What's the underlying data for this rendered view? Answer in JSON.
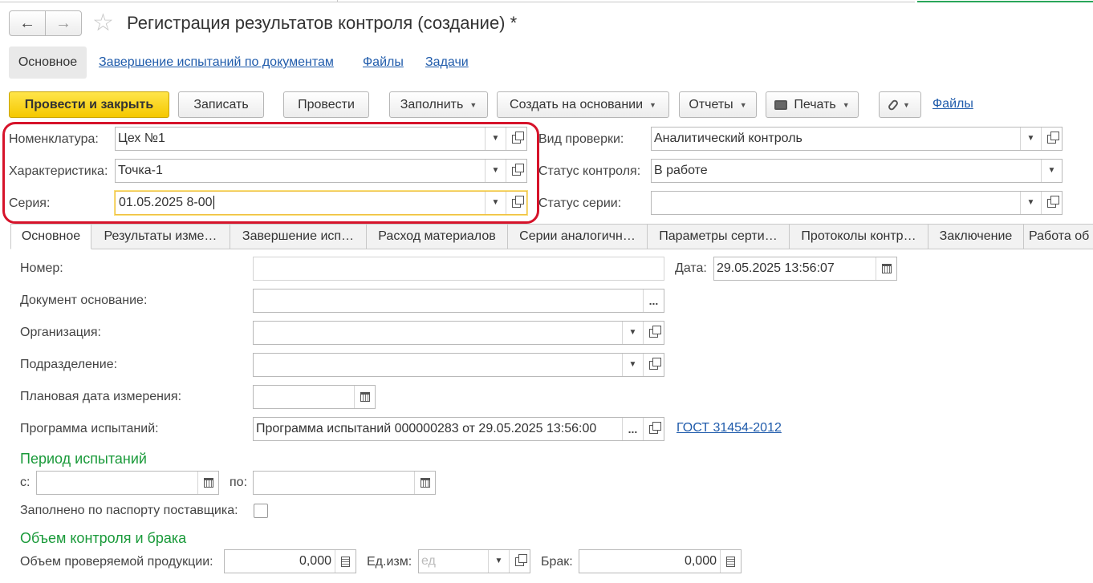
{
  "window": {
    "title": "Регистрация результатов контроля (создание) *"
  },
  "section_tabs": [
    "Основное",
    "Завершение испытаний по документам",
    "Файлы",
    "Задачи"
  ],
  "toolbar": {
    "post_close": "Провести и закрыть",
    "save": "Записать",
    "post": "Провести",
    "fill": "Заполнить",
    "create_based": "Создать на основании",
    "reports": "Отчеты",
    "print": "Печать",
    "files_link": "Файлы"
  },
  "header": {
    "nomenclature": {
      "label": "Номенклатура:",
      "value": "Цех №1"
    },
    "characteristic": {
      "label": "Характеристика:",
      "value": "Точка-1"
    },
    "series": {
      "label": "Серия:",
      "value": "01.05.2025 8-00"
    },
    "check_type": {
      "label": "Вид проверки:",
      "value": "Аналитический контроль"
    },
    "control_status": {
      "label": "Статус контроля:",
      "value": "В работе"
    },
    "series_status": {
      "label": "Статус серии:",
      "value": ""
    }
  },
  "tabs": [
    "Основное",
    "Результаты изме…",
    "Завершение исп…",
    "Расход материалов",
    "Серии аналогичн…",
    "Параметры серти…",
    "Протоколы контр…",
    "Заключение",
    "Работа об"
  ],
  "main": {
    "number": {
      "label": "Номер:",
      "value": ""
    },
    "date": {
      "label": "Дата:",
      "value": "29.05.2025 13:56:07"
    },
    "base_doc": {
      "label": "Документ основание:",
      "value": ""
    },
    "organization": {
      "label": "Организация:",
      "value": ""
    },
    "department": {
      "label": "Подразделение:",
      "value": ""
    },
    "planned_date": {
      "label": "Плановая дата измерения:",
      "value": "  .  ."
    },
    "program": {
      "label": "Программа испытаний:",
      "value": "Программа испытаний 000000283 от 29.05.2025 13:56:00",
      "link": "ГОСТ 31454-2012"
    },
    "period": {
      "heading": "Период испытаний",
      "from_label": "с:",
      "from_value": "  .  .        :  :",
      "to_label": "по:",
      "to_value": "  .  .        :  :"
    },
    "by_passport": {
      "label": "Заполнено по паспорту поставщика:"
    },
    "volume": {
      "heading": "Объем контроля и брака",
      "checked_label": "Объем проверяемой продукции:",
      "checked_value": "0,000",
      "unit_label": "Ед.изм:",
      "unit_placeholder": "ед",
      "defect_label": "Брак:",
      "defect_value": "0,000"
    }
  },
  "colors": {
    "accent_yellow": "#f5c800",
    "link": "#1f5bab",
    "highlight_red": "#d6132a",
    "heading_green": "#1a9a3a"
  }
}
